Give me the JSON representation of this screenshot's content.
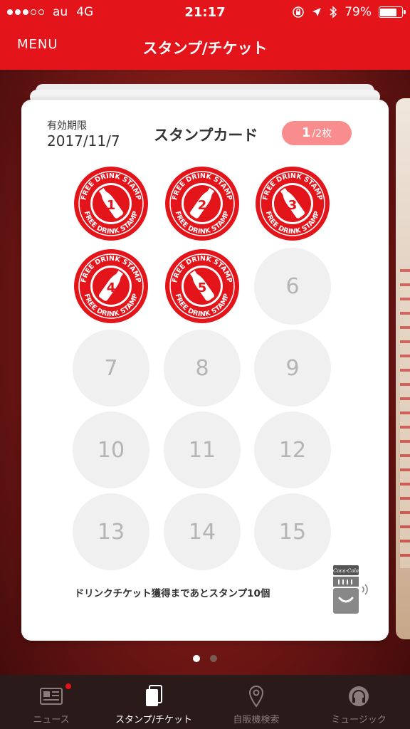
{
  "status_bar": {
    "carrier": "au",
    "network": "4G",
    "time": "21:17",
    "battery": "79%",
    "battery_level": 0.79
  },
  "nav": {
    "menu_label": "MENU",
    "title": "スタンプ/チケット"
  },
  "card": {
    "expiry_label": "有効期限",
    "expiry_date": "2017/11/7",
    "title": "スタンプカード",
    "page_current": "1",
    "page_total": "/2枚",
    "stamp_text": "FREE DRINK STAMP",
    "slots": [
      {
        "number": "1",
        "stamped": true
      },
      {
        "number": "2",
        "stamped": true
      },
      {
        "number": "3",
        "stamped": true
      },
      {
        "number": "4",
        "stamped": true
      },
      {
        "number": "5",
        "stamped": true
      },
      {
        "number": "6",
        "stamped": false
      },
      {
        "number": "7",
        "stamped": false
      },
      {
        "number": "8",
        "stamped": false
      },
      {
        "number": "9",
        "stamped": false
      },
      {
        "number": "10",
        "stamped": false
      },
      {
        "number": "11",
        "stamped": false
      },
      {
        "number": "12",
        "stamped": false
      },
      {
        "number": "13",
        "stamped": false
      },
      {
        "number": "14",
        "stamped": false
      },
      {
        "number": "15",
        "stamped": false
      }
    ],
    "progress_message": "ドリンクチケット獲得まであとスタンプ10個",
    "vending_brand": "Coca-Cola"
  },
  "pager": {
    "pages": 2,
    "active": 0
  },
  "tabs": [
    {
      "label": "ニュース",
      "icon": "newspaper-icon",
      "active": false,
      "badge": true
    },
    {
      "label": "スタンプ/チケット",
      "icon": "cards-icon",
      "active": true,
      "badge": false
    },
    {
      "label": "自販機検索",
      "icon": "location-pin-icon",
      "active": false,
      "badge": false
    },
    {
      "label": "ミュージック",
      "icon": "headphones-icon",
      "active": false,
      "badge": false
    }
  ],
  "colors": {
    "brand_red": "#e4141b",
    "badge_pink": "#f98c8c",
    "stamp_red": "#e4141b",
    "empty_slot": "#f0f0f0",
    "tabbar_bg": "#2a1a1a"
  }
}
